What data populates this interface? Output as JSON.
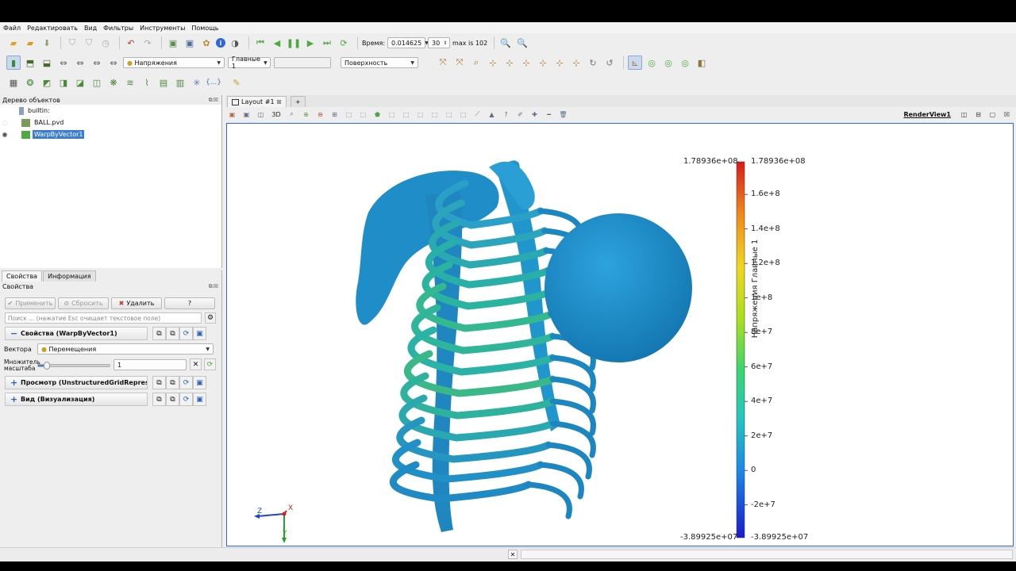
{
  "menu": [
    "Файл",
    "Редактировать",
    "Вид",
    "Фильтры",
    "Инструменты",
    "Помощь"
  ],
  "toolbar": {
    "time_label": "Время:",
    "time_value": "0.014625",
    "timestep_value": "30",
    "max_label": "max is 102",
    "array_combo": "Напряжения",
    "component_combo": "Главные 1",
    "representation_combo": "Поверхность"
  },
  "pipeline": {
    "title": "Дерево объектов",
    "items": [
      {
        "label": "builtin:"
      },
      {
        "label": "BALL.pvd"
      },
      {
        "label": "WarpByVector1"
      }
    ]
  },
  "props": {
    "tabs": [
      "Свойства",
      "Информация"
    ],
    "panel_title": "Свойства",
    "apply": "Применить",
    "reset": "Сбросить",
    "delete": "Удалить",
    "help": "?",
    "search_placeholder": "Поиск ... (нажатие Esc очищает текстовое поле)",
    "section_properties": "Свойства (WarpByVector1)",
    "vectors_label": "Вектора",
    "vectors_value": "Перемещения",
    "scale_label_1": "Множитель",
    "scale_label_2": "масштаба",
    "scale_value": "1",
    "scale_fraction": 0.12,
    "section_display": "Просмотр (UnstructuredGridRepresenta",
    "section_view": "Вид (Визуализация)"
  },
  "view": {
    "layout_tab": "Layout #1",
    "add_tab": "+",
    "render_view_name": "RenderView1",
    "mode_3d": "3D"
  },
  "colorbar": {
    "title": "Напряжения Главные 1",
    "max_label": "1.78936e+08",
    "min_label": "-3.89925e+07",
    "ticks": [
      "1.6e+8",
      "1.4e+8",
      "1.2e+8",
      "1e+8",
      "8e+7",
      "6e+7",
      "4e+7",
      "2e+7",
      "0",
      "-2e+7"
    ],
    "min": -38992500,
    "max": 178936000
  },
  "axes": {
    "x": "X",
    "y": "Y",
    "z": "Z"
  },
  "colors": {
    "accent": "#3a7dd0",
    "model": "#1f8ec8",
    "border": "#2f66d9"
  }
}
